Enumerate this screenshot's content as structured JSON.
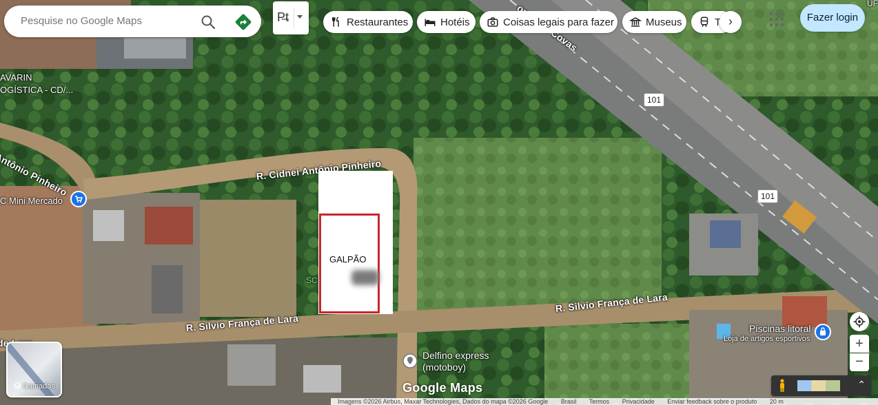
{
  "search": {
    "placeholder": "Pesquise no Google Maps",
    "search_icon": "search-icon",
    "directions_icon": "directions-icon"
  },
  "travel_mode": {
    "icon": "transit-icon",
    "label": "P̶t"
  },
  "chips": [
    {
      "label": "Restaurantes",
      "icon": "fork-knife-icon"
    },
    {
      "label": "Hotéis",
      "icon": "bed-icon"
    },
    {
      "label": "Coisas legais para fazer",
      "icon": "camera-icon"
    },
    {
      "label": "Museus",
      "icon": "museum-icon"
    },
    {
      "label": "Tr",
      "icon": "train-icon"
    }
  ],
  "header": {
    "login_label": "Fazer login"
  },
  "map": {
    "streets": {
      "cidnei": "R. Cidnei Antônio Pinheiro",
      "silvio_right": "R. Silvio França de Lara",
      "silvio_left": "R. Silvio França de Lara",
      "antonio_left": "Antônio Pinheiro",
      "covas": "or Mário Covas",
      "lara_fragment": "de Lara"
    },
    "highway_shields": [
      "101",
      "101"
    ],
    "places": {
      "mini_mercado": "C Mini Mercado",
      "avarin": "AVARIN\nOGÍSTICA - CD/...",
      "delfino": "Delfino express\n(motoboy)",
      "piscinas_name": "Piscinas litoral",
      "piscinas_category": "Loja de artigos esportivos",
      "sc_fragment": "SC",
      "top_right": "UF"
    },
    "overlay_label": "GALPÃO"
  },
  "controls": {
    "layers_label": "Camadas",
    "zoom_in": "+",
    "zoom_out": "−"
  },
  "watermark": "Google Maps",
  "footer": {
    "imagery": "Imagens ©2026 Airbus, Maxar Technologies, Dados do mapa ©2026 Google",
    "country": "Brasil",
    "terms": "Termos",
    "privacy": "Privacidade",
    "feedback": "Enviar feedback sobre o produto",
    "scale": "20 m"
  },
  "colors": {
    "overlay_border": "#c8262e",
    "login_bg": "#c2e7ff",
    "poi_blue": "#1a73e8",
    "directions": "#188038"
  }
}
